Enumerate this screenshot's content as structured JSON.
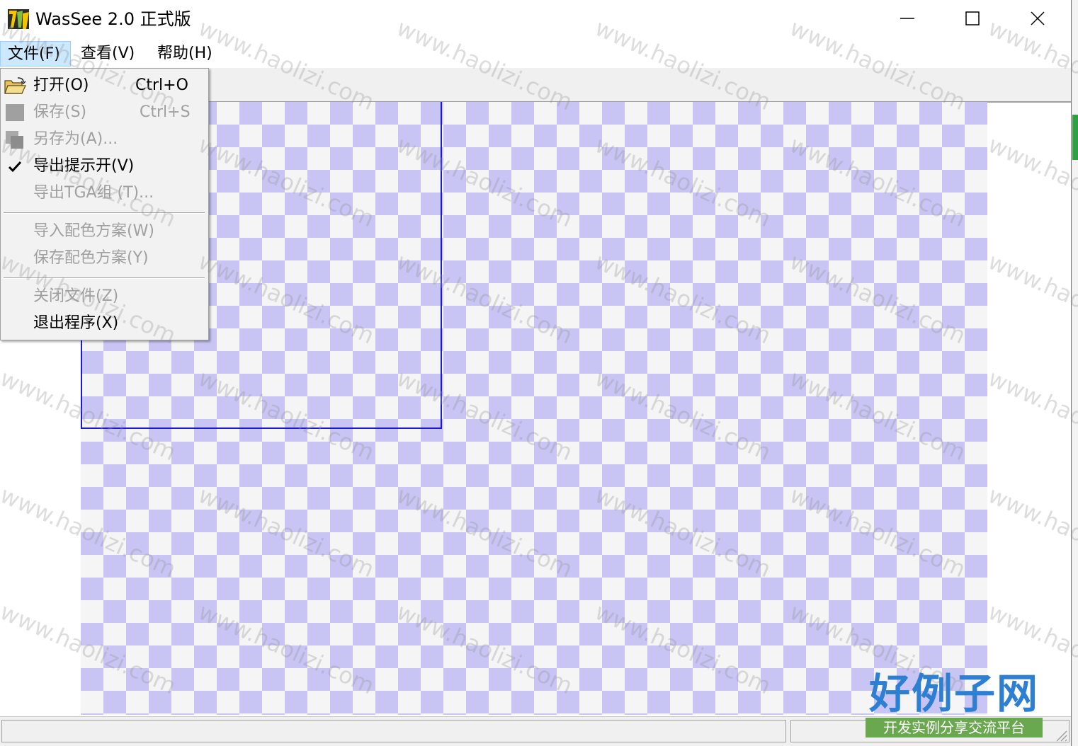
{
  "window": {
    "title": "WasSee 2.0 正式版",
    "icon": "wassee-app-icon",
    "controls": {
      "minimize": "minimize-icon",
      "maximize": "maximize-icon",
      "close": "close-icon"
    }
  },
  "menubar": {
    "items": [
      {
        "label": "文件(F)",
        "active": true
      },
      {
        "label": "查看(V)"
      },
      {
        "label": "帮助(H)"
      }
    ]
  },
  "file_menu": {
    "items": [
      {
        "label": "打开(O)",
        "shortcut": "Ctrl+O",
        "icon": "open-folder-icon",
        "enabled": true
      },
      {
        "label": "保存(S)",
        "shortcut": "Ctrl+S",
        "icon": "save-icon",
        "enabled": false
      },
      {
        "label": "另存为(A)...",
        "icon": "save-as-icon",
        "enabled": false
      },
      {
        "label": "导出提示开(V)",
        "icon": "checkmark-icon",
        "checked": true,
        "enabled": true
      },
      {
        "label": "导出TGA组 (T)...",
        "enabled": false
      },
      {
        "label": "导入配色方案(W)",
        "enabled": false
      },
      {
        "label": "保存配色方案(Y)",
        "enabled": false
      },
      {
        "label": "关闭文件(Z)",
        "enabled": false
      },
      {
        "label": "退出程序(X)",
        "enabled": true
      }
    ]
  },
  "watermark": {
    "text": "www.haolizi.com"
  },
  "brand": {
    "title": "好例子网",
    "subtitle": "开发实例分享交流平台"
  },
  "colors": {
    "checker_light": "#f5f5f5",
    "checker_dark": "#c8c4f4",
    "frame_border": "#1a1ad6",
    "menu_highlight": "#cce8ff",
    "brand_blue": "#2c7fd1",
    "brand_green": "#6aa84f"
  }
}
